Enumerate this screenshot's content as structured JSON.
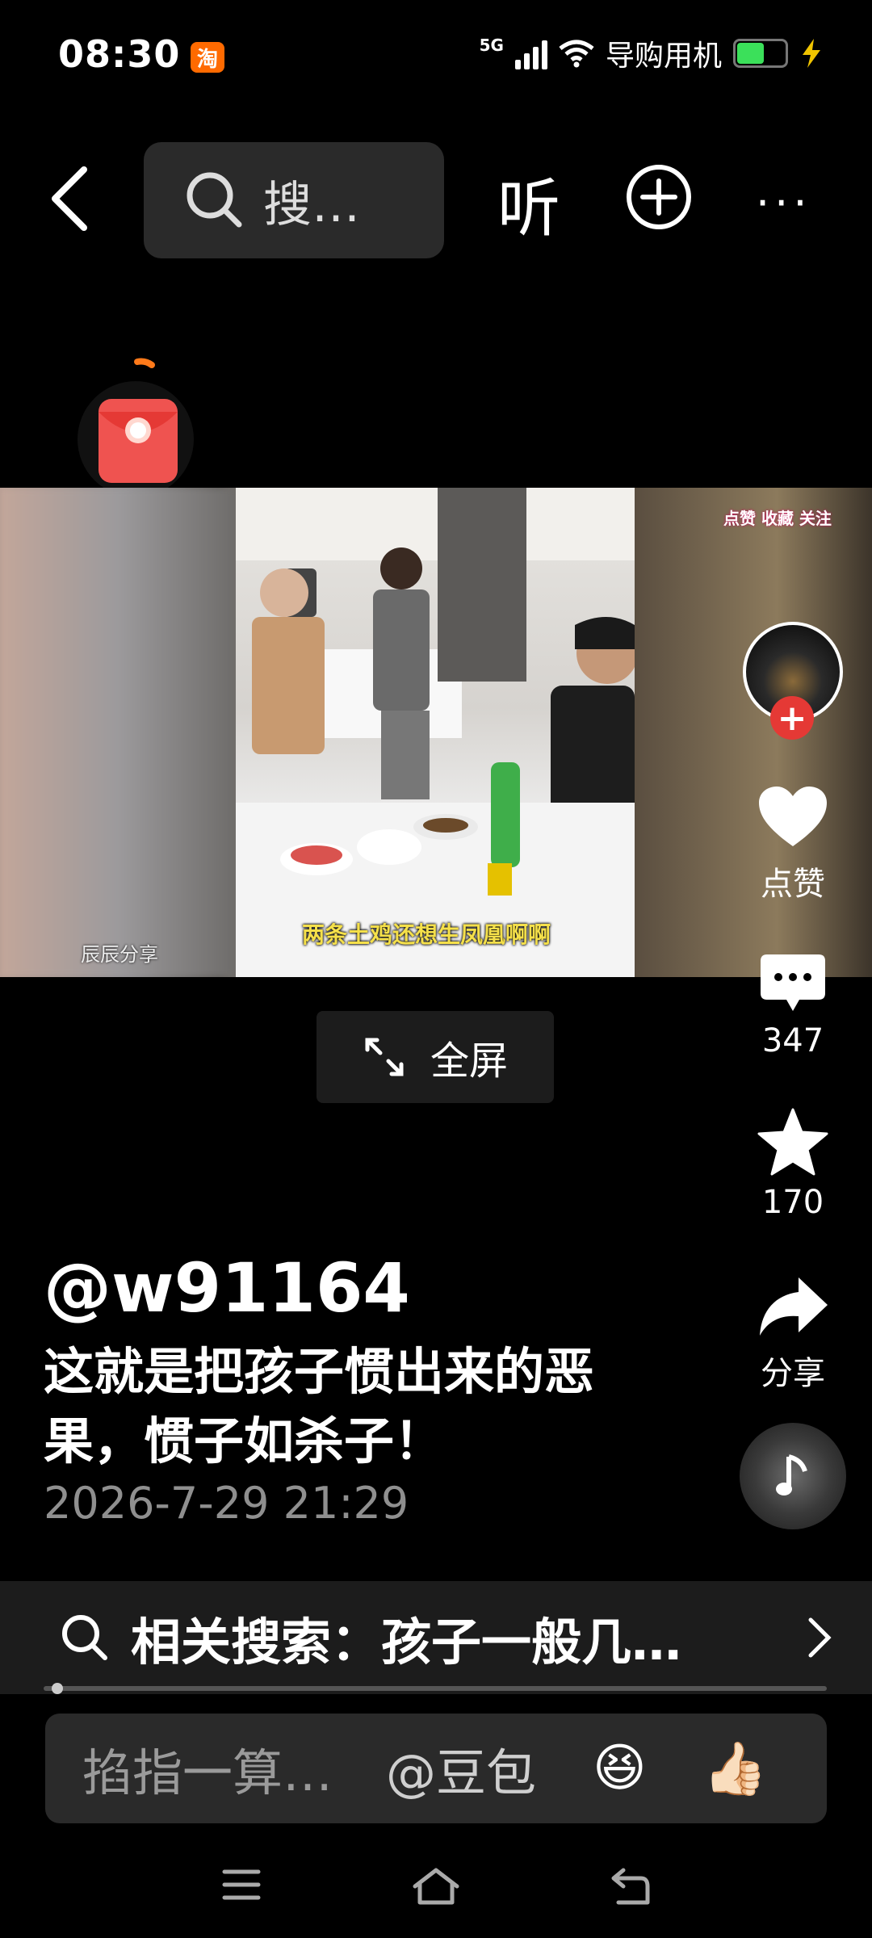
{
  "status_bar": {
    "time": "08:30",
    "app_badge": "淘",
    "network": "5G",
    "operator": "导购用机",
    "battery_level": 0.6
  },
  "top_nav": {
    "search_placeholder": "搜…",
    "listen_label": "听",
    "more_label": "···"
  },
  "video": {
    "subtitle": "两条土鸡还想生凤凰啊啊",
    "watermark": "辰辰分享",
    "corner_label": "点赞 收藏 关注"
  },
  "fullscreen_label": "全屏",
  "right_rail": {
    "follow_icon": "+",
    "like_label": "点赞",
    "comment_count": "347",
    "favorite_count": "170",
    "share_label": "分享"
  },
  "post": {
    "username": "@w91164",
    "caption": "这就是把孩子惯出来的恶果，惯子如杀子！",
    "date": "2026-7-29 21:29"
  },
  "related_search": {
    "text": "相关搜索：孩子一般几…"
  },
  "video_progress": 0.01,
  "comment_bar": {
    "placeholder": "掐指一算…",
    "mention": "@豆包",
    "emoji_laugh": "😆",
    "emoji_thumb": "👍🏻"
  },
  "colors": {
    "accent_red": "#e53935",
    "subtitle_yellow": "#f5e04a",
    "battery_green": "#3be05a"
  },
  "icons": [
    "back-icon",
    "search-icon",
    "add-icon",
    "more-icon",
    "red-packet-icon",
    "fullscreen-icon",
    "heart-icon",
    "comment-icon",
    "star-icon",
    "share-icon",
    "music-icon",
    "chevron-right-icon",
    "menu-icon",
    "home-icon",
    "back-nav-icon"
  ]
}
